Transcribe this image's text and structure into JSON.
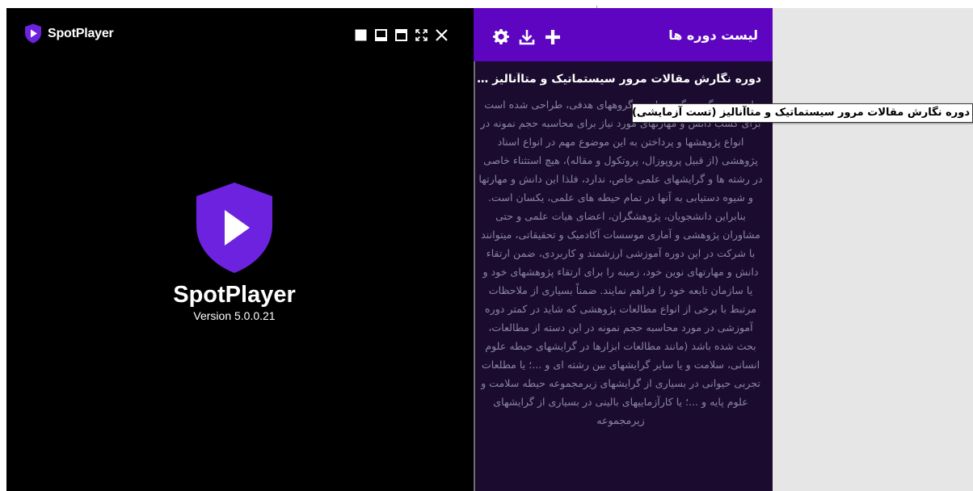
{
  "app": {
    "brand_name": "SpotPlayer",
    "center_name": "SpotPlayer",
    "version": "Version 5.0.0.21",
    "colors": {
      "brand_purple": "#5e05c2",
      "shield_purple": "#6d22e0",
      "panel_bg": "#1b0c2f"
    }
  },
  "window_controls": [
    {
      "icon": "square-filled-icon"
    },
    {
      "icon": "window-bottom-bar-icon"
    },
    {
      "icon": "window-top-bar-icon"
    },
    {
      "icon": "fullscreen-icon"
    },
    {
      "icon": "close-icon"
    }
  ],
  "panel": {
    "title": "لیست دوره ها",
    "actions": [
      {
        "icon": "plus-icon"
      },
      {
        "icon": "download-icon"
      },
      {
        "icon": "gear-icon"
      }
    ],
    "course": {
      "title": "دوره نگارش مقالات مرور سیستماتیک و متاآنالیز (تست آزمایشی)",
      "description": "با توجه به گستردگی جوامع و گروههای هدفی، طراحی شده است برای کسب دانش و مهارتهای مورد نیاز برای محاسبه حجم نمونه در انواع پژوهشها و پرداختن به این موضوع مهم در انواع اسناد پژوهشی (از قبیل پروپوزال، پروتکول و مقاله)، هیچ استثناء خاصی در رشته ها و گرایشهای علمی خاص، ندارد، فلذا این دانش و مهارتها و شیوه دستیابی به آنها در تمام حیطه های علمی، یکسان است. بنابراین دانشجویان، پژوهشگران، اعضای هیات علمی و حتی مشاوران پژوهشی و آماری موسسات آکادمیک و تحقیقاتی، میتوانند با شرکت در این دوره آموزشی ارزشمند و کاربردی، ضمن ارتقاء دانش و مهارتهای نوین خود، زمینه را برای ارتقاء پژوهشهای خود و یا سازمان تابعه خود را فراهم نمایند. ضمناً بسیاری از ملاحظات مرتبط با برخی از انواع مطالعات پژوهشی که شاید در کمتر دوره آموزشی در مورد محاسبه حجم نمونه در این دسته از مطالعات، بحث شده باشد (مانند مطالعات ابزارها در گرایشهای حیطه علوم انسانی، سلامت و یا سایر گرایشهای بین رشته ای و ...؛ یا مطلعات تجربی حیوانی در بسیاری از گرایشهای زیرمجموعه حیطه سلامت و علوم پایه و ...؛ یا کارآزماییهای بالینی در بسیاری از گرایشهای زیرمجموعه"
    }
  },
  "tooltip": {
    "text": "دوره نگارش مقالات مرور سیستماتیک و متاآنالیز (تست آزمایشی)"
  }
}
